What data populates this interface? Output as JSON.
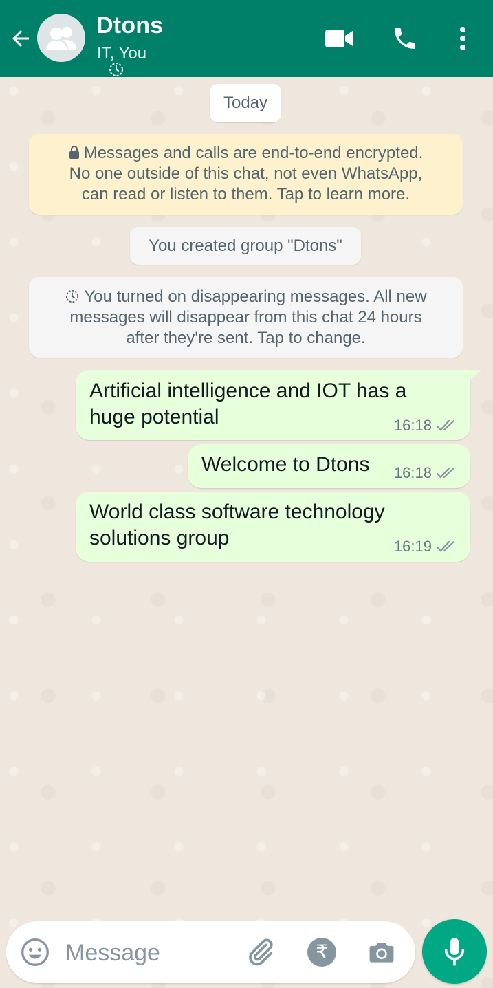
{
  "header": {
    "title": "Dtons",
    "subtitle": "IT, You"
  },
  "chat": {
    "date_label": "Today",
    "encryption_notice": {
      "line1": "Messages and calls are end-to-end encrypted.",
      "line2": "No one outside of this chat, not even WhatsApp,",
      "line3": "can read or listen to them. Tap to learn more."
    },
    "created_group": "You created group \"Dtons\"",
    "disappearing_notice": {
      "line1": "You turned on disappearing messages. All new",
      "line2": "messages will disappear from this chat 24 hours",
      "line3": "after they're sent. Tap to change."
    },
    "messages": [
      {
        "line1": "Artificial intelligence and IOT has a",
        "line2": "huge potential",
        "time": "16:18",
        "status": "read"
      },
      {
        "line1": "Welcome to Dtons",
        "time": "16:18",
        "status": "read"
      },
      {
        "line1": "World class software technology",
        "line2": "solutions group",
        "time": "16:19",
        "status": "read"
      }
    ]
  },
  "composer": {
    "placeholder": "Message",
    "rupee_symbol": "₹"
  },
  "colors": {
    "header": "#008069",
    "outgoing_bubble": "#e7ffdb",
    "encryption_bg": "#fdf2cd",
    "mic_button": "#00a884"
  },
  "icons": [
    "back-arrow-icon",
    "group-avatar-icon",
    "timer-icon",
    "video-call-icon",
    "phone-icon",
    "more-vert-icon",
    "lock-icon",
    "double-check-icon",
    "emoji-icon",
    "attach-icon",
    "rupee-icon",
    "camera-icon",
    "mic-icon"
  ]
}
